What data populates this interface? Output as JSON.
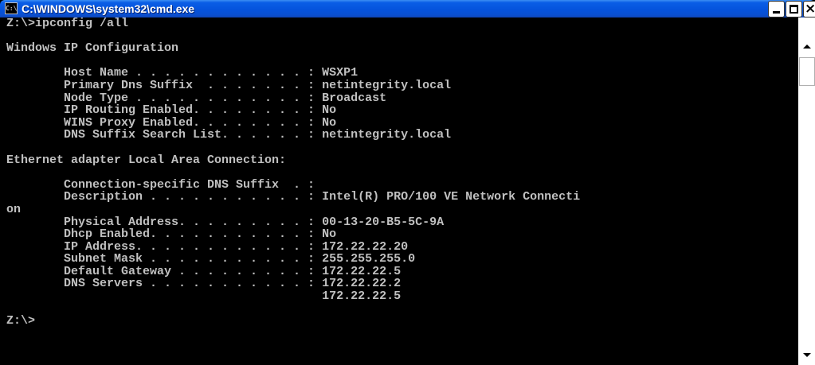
{
  "window": {
    "title": "C:\\WINDOWS\\system32\\cmd.exe",
    "icon_label": "C:\\",
    "controls": {
      "minimize": "minimize-icon",
      "maximize": "maximize-icon",
      "close": "close-icon",
      "close_glyph": "×"
    }
  },
  "console": {
    "text": "Z:\\>ipconfig /all\n\nWindows IP Configuration\n\n        Host Name . . . . . . . . . . . . : WSXP1\n        Primary Dns Suffix  . . . . . . . : netintegrity.local\n        Node Type . . . . . . . . . . . . : Broadcast\n        IP Routing Enabled. . . . . . . . : No\n        WINS Proxy Enabled. . . . . . . . : No\n        DNS Suffix Search List. . . . . . : netintegrity.local\n\nEthernet adapter Local Area Connection:\n\n        Connection-specific DNS Suffix  . :\n        Description . . . . . . . . . . . : Intel(R) PRO/100 VE Network Connecti\non\n        Physical Address. . . . . . . . . : 00-13-20-B5-5C-9A\n        Dhcp Enabled. . . . . . . . . . . : No\n        IP Address. . . . . . . . . . . . : 172.22.22.20\n        Subnet Mask . . . . . . . . . . . : 255.255.255.0\n        Default Gateway . . . . . . . . . : 172.22.22.5\n        DNS Servers . . . . . . . . . . . : 172.22.22.2\n                                            172.22.22.5\n\nZ:\\>"
  },
  "colors": {
    "title_bar": "#0553dc",
    "console_bg": "#000000",
    "console_fg": "#c0c0c0"
  }
}
